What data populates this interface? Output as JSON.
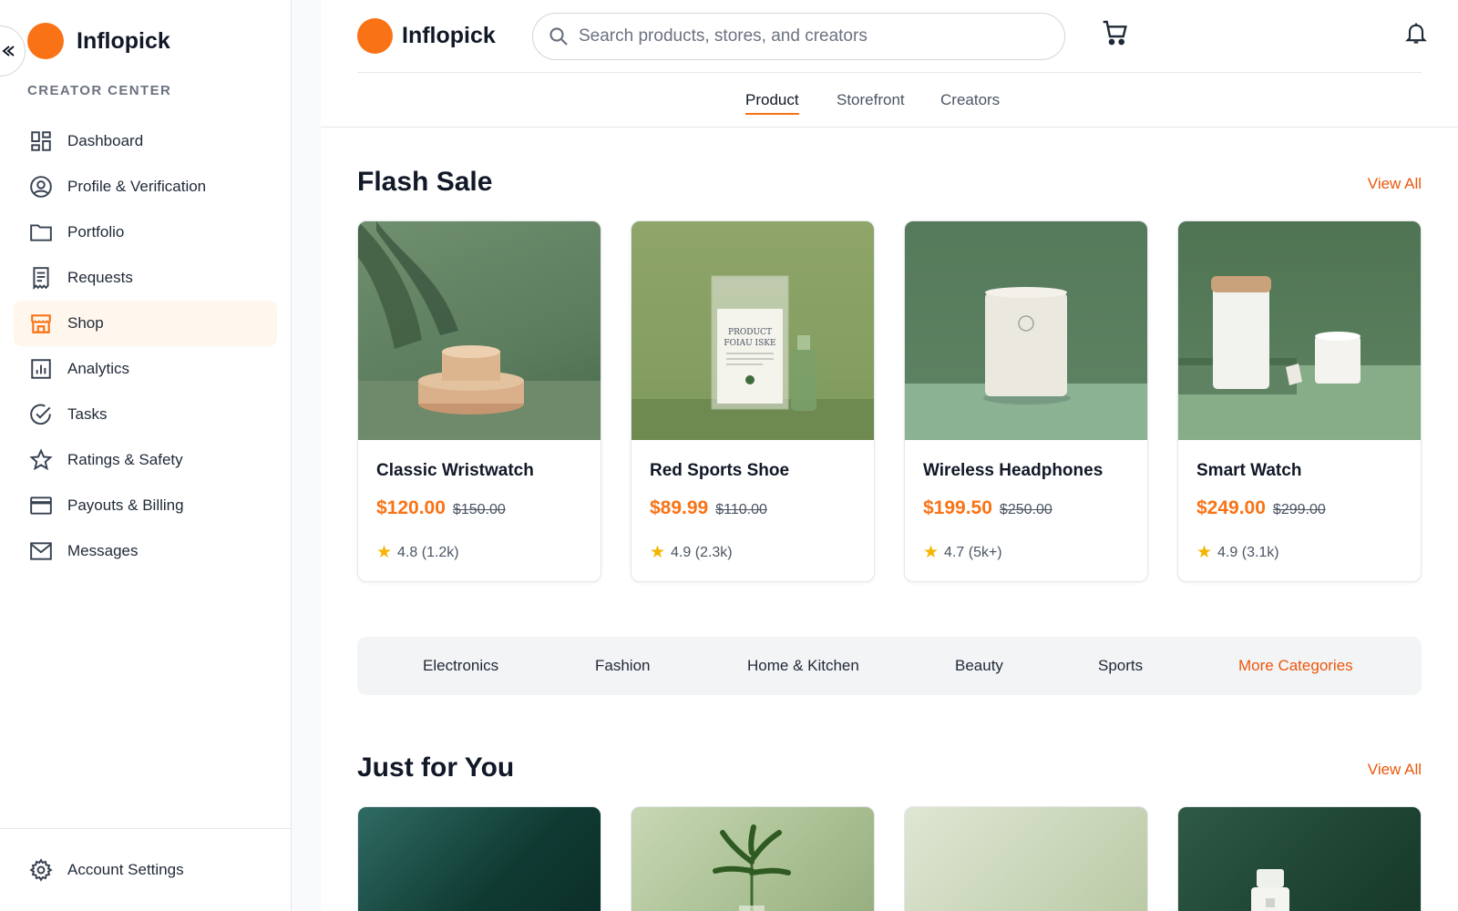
{
  "sidebar": {
    "brand": "Inflopick",
    "section": "CREATOR CENTER",
    "items": [
      {
        "label": "Dashboard",
        "icon": "dashboard-icon"
      },
      {
        "label": "Profile & Verification",
        "icon": "user-circle-icon"
      },
      {
        "label": "Portfolio",
        "icon": "folder-icon"
      },
      {
        "label": "Requests",
        "icon": "receipt-icon"
      },
      {
        "label": "Shop",
        "icon": "store-icon",
        "active": true
      },
      {
        "label": "Analytics",
        "icon": "analytics-icon"
      },
      {
        "label": "Tasks",
        "icon": "check-circle-icon"
      },
      {
        "label": "Ratings & Safety",
        "icon": "star-icon"
      },
      {
        "label": "Payouts & Billing",
        "icon": "credit-card-icon"
      },
      {
        "label": "Messages",
        "icon": "mail-icon"
      }
    ],
    "footer": {
      "label": "Account Settings",
      "icon": "gear-icon"
    }
  },
  "header": {
    "brand": "Inflopick",
    "search_placeholder": "Search products, stores, and creators",
    "tabs": [
      "Product",
      "Storefront",
      "Creators"
    ],
    "active_tab": "Product"
  },
  "flash_sale": {
    "title": "Flash Sale",
    "view_all": "View All",
    "products": [
      {
        "name": "Classic Wristwatch",
        "price": "$120.00",
        "old_price": "$150.00",
        "rating": "4.8 (1.2k)"
      },
      {
        "name": "Red Sports Shoe",
        "price": "$89.99",
        "old_price": "$110.00",
        "rating": "4.9 (2.3k)"
      },
      {
        "name": "Wireless Headphones",
        "price": "$199.50",
        "old_price": "$250.00",
        "rating": "4.7 (5k+)"
      },
      {
        "name": "Smart Watch",
        "price": "$249.00",
        "old_price": "$299.00",
        "rating": "4.9 (3.1k)"
      }
    ]
  },
  "product_label": {
    "line1": "PRODUCT",
    "line2": "FOIAU ISKE"
  },
  "categories": [
    "Electronics",
    "Fashion",
    "Home & Kitchen",
    "Beauty",
    "Sports",
    "More Categories"
  ],
  "just_for_you": {
    "title": "Just for You",
    "view_all": "View All"
  },
  "colors": {
    "accent": "#f97316",
    "accent_text": "#ea580c",
    "active_bg": "#fff7ed",
    "star": "#f5b400"
  }
}
